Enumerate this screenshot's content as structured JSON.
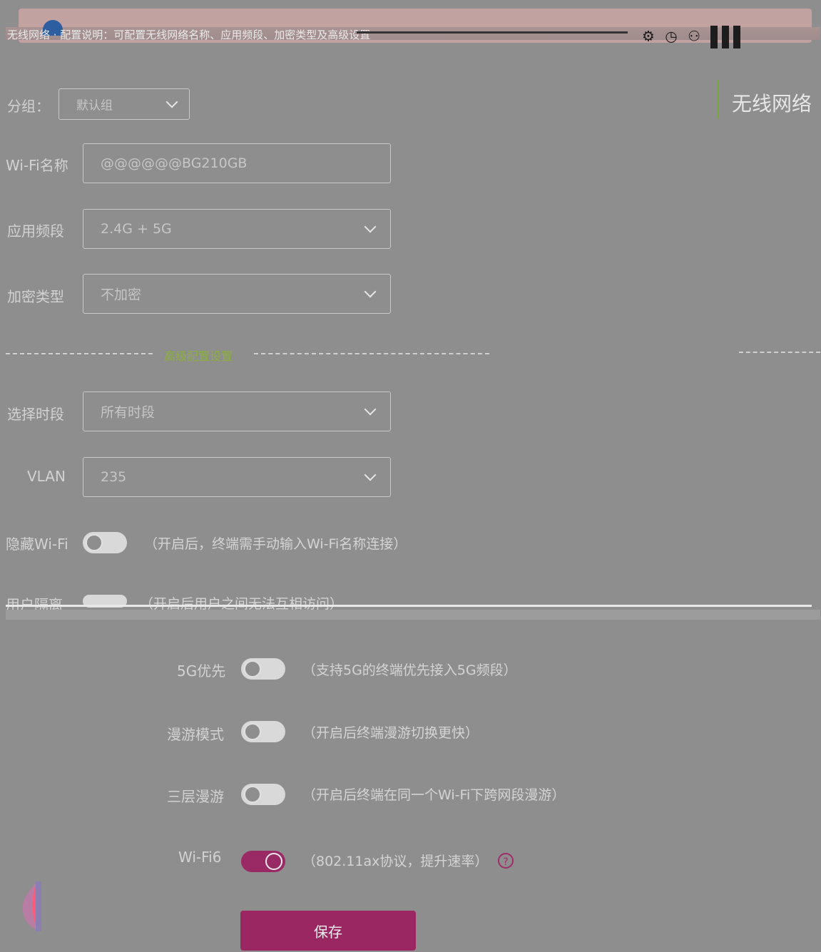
{
  "banner": {
    "text": "无线网络 · 配置说明：可配置无线网络名称、应用频段、加密类型及高级设置",
    "icons": "⚙ ◷ ⚇"
  },
  "right_panel": {
    "title": "无线网络"
  },
  "form": {
    "group_label": "分组：",
    "group_value": "默认组",
    "wifi_name_label": "Wi-Fi名称",
    "wifi_name_value": "@@@@@@BG210GB",
    "band_label": "应用频段",
    "band_value": "2.4G + 5G",
    "encryption_label": "加密类型",
    "encryption_value": "不加密",
    "advanced_title": "高级配置设置",
    "time_label": "选择时段",
    "time_value": "所有时段",
    "vlan_label": "VLAN",
    "vlan_value": "235",
    "hide_wifi_label": "隐藏Wi-Fi",
    "hide_wifi_hint": "（开启后，终端需手动输入Wi-Fi名称连接）",
    "client_isolation_label": "用户隔离",
    "client_isolation_hint": "（开启后用户之间无法互相访问）"
  },
  "advanced": {
    "band_steering_label": "5G优先",
    "band_steering_hint": "（支持5G的终端优先接入5G频段）",
    "roaming_label": "漫游模式",
    "roaming_hint": "（开启后终端漫游切换更快）",
    "layer3_label": "三层漫游",
    "layer3_hint": "（开启后终端在同一个Wi-Fi下跨网段漫游）",
    "wifi6_label": "Wi-Fi6",
    "wifi6_hint": "（802.11ax协议，提升速率）",
    "wifi6_on": true,
    "help_symbol": "?"
  },
  "actions": {
    "save_label": "保存"
  },
  "colors": {
    "accent": "#9a2762",
    "green": "#76a83a"
  }
}
